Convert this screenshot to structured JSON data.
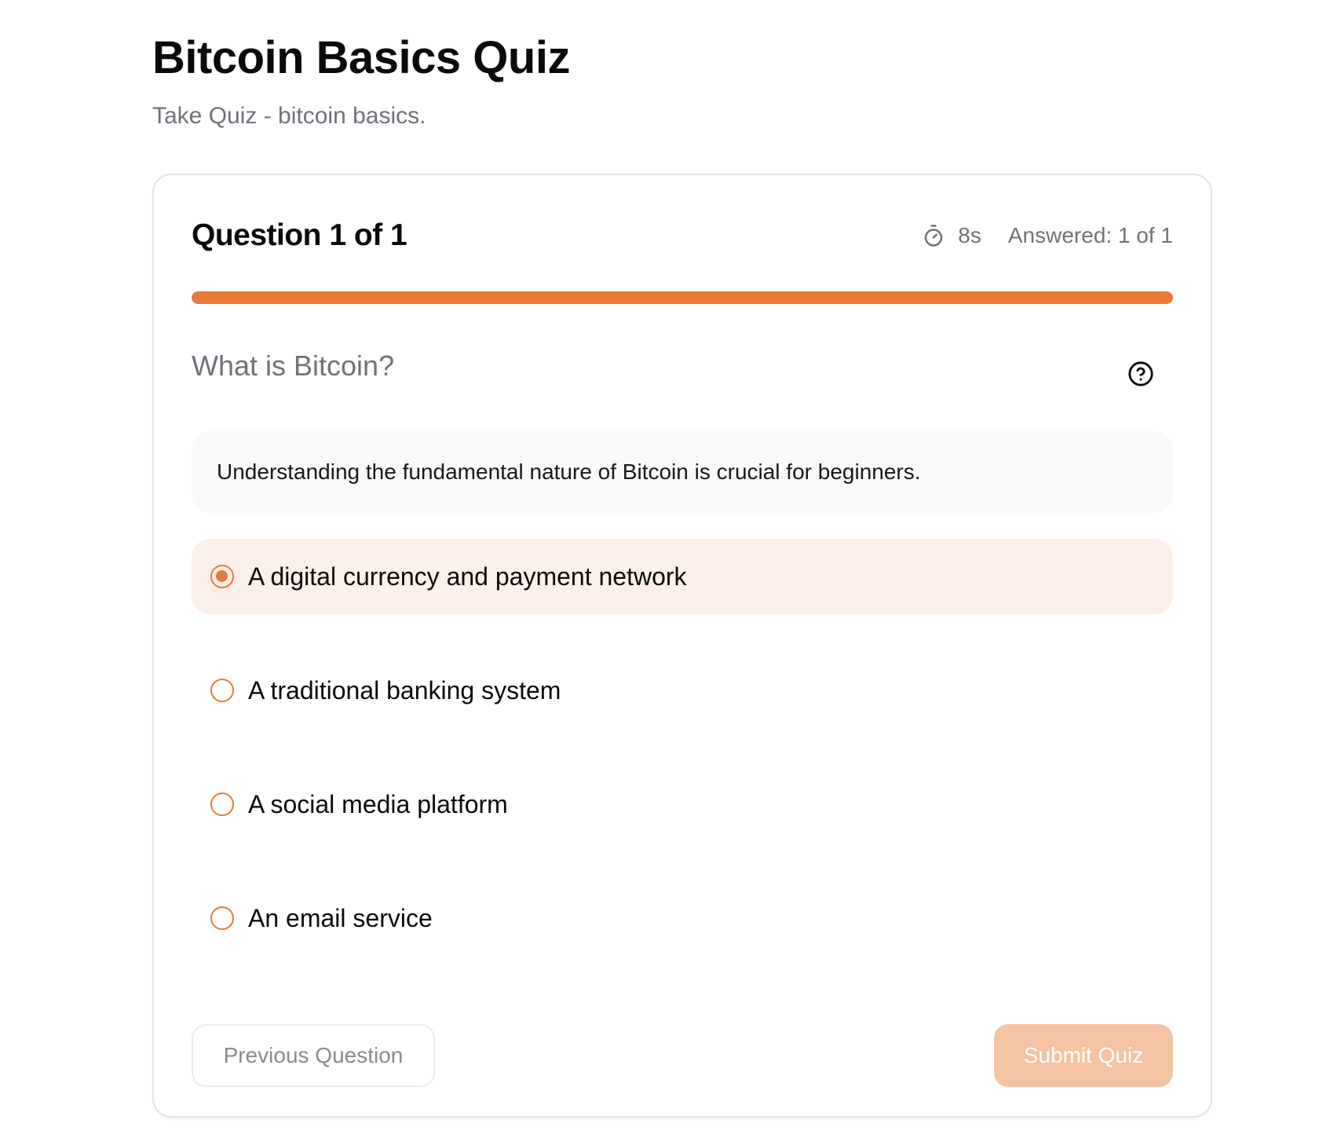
{
  "page": {
    "title": "Bitcoin Basics Quiz",
    "subtitle": "Take Quiz - bitcoin basics."
  },
  "quiz": {
    "counter": "Question 1 of 1",
    "timer": "8s",
    "answered": "Answered: 1 of 1",
    "progress_percent": 100,
    "question": "What is Bitcoin?",
    "hint": "Understanding the fundamental nature of Bitcoin is crucial for beginners.",
    "options": [
      {
        "label": "A digital currency and payment network",
        "selected": true
      },
      {
        "label": "A traditional banking system",
        "selected": false
      },
      {
        "label": "A social media platform",
        "selected": false
      },
      {
        "label": "An email service",
        "selected": false
      }
    ],
    "selected_index": 0
  },
  "actions": {
    "previous_label": "Previous Question",
    "submit_label": "Submit Quiz",
    "submit_disabled": true
  },
  "icons": {
    "timer": "timer-icon",
    "hint": "help-circle-icon"
  },
  "colors": {
    "accent": "#e87936",
    "selected_background": "#fbefe9",
    "submit_disabled": "#f3c3a4",
    "muted_text": "#71717a"
  }
}
